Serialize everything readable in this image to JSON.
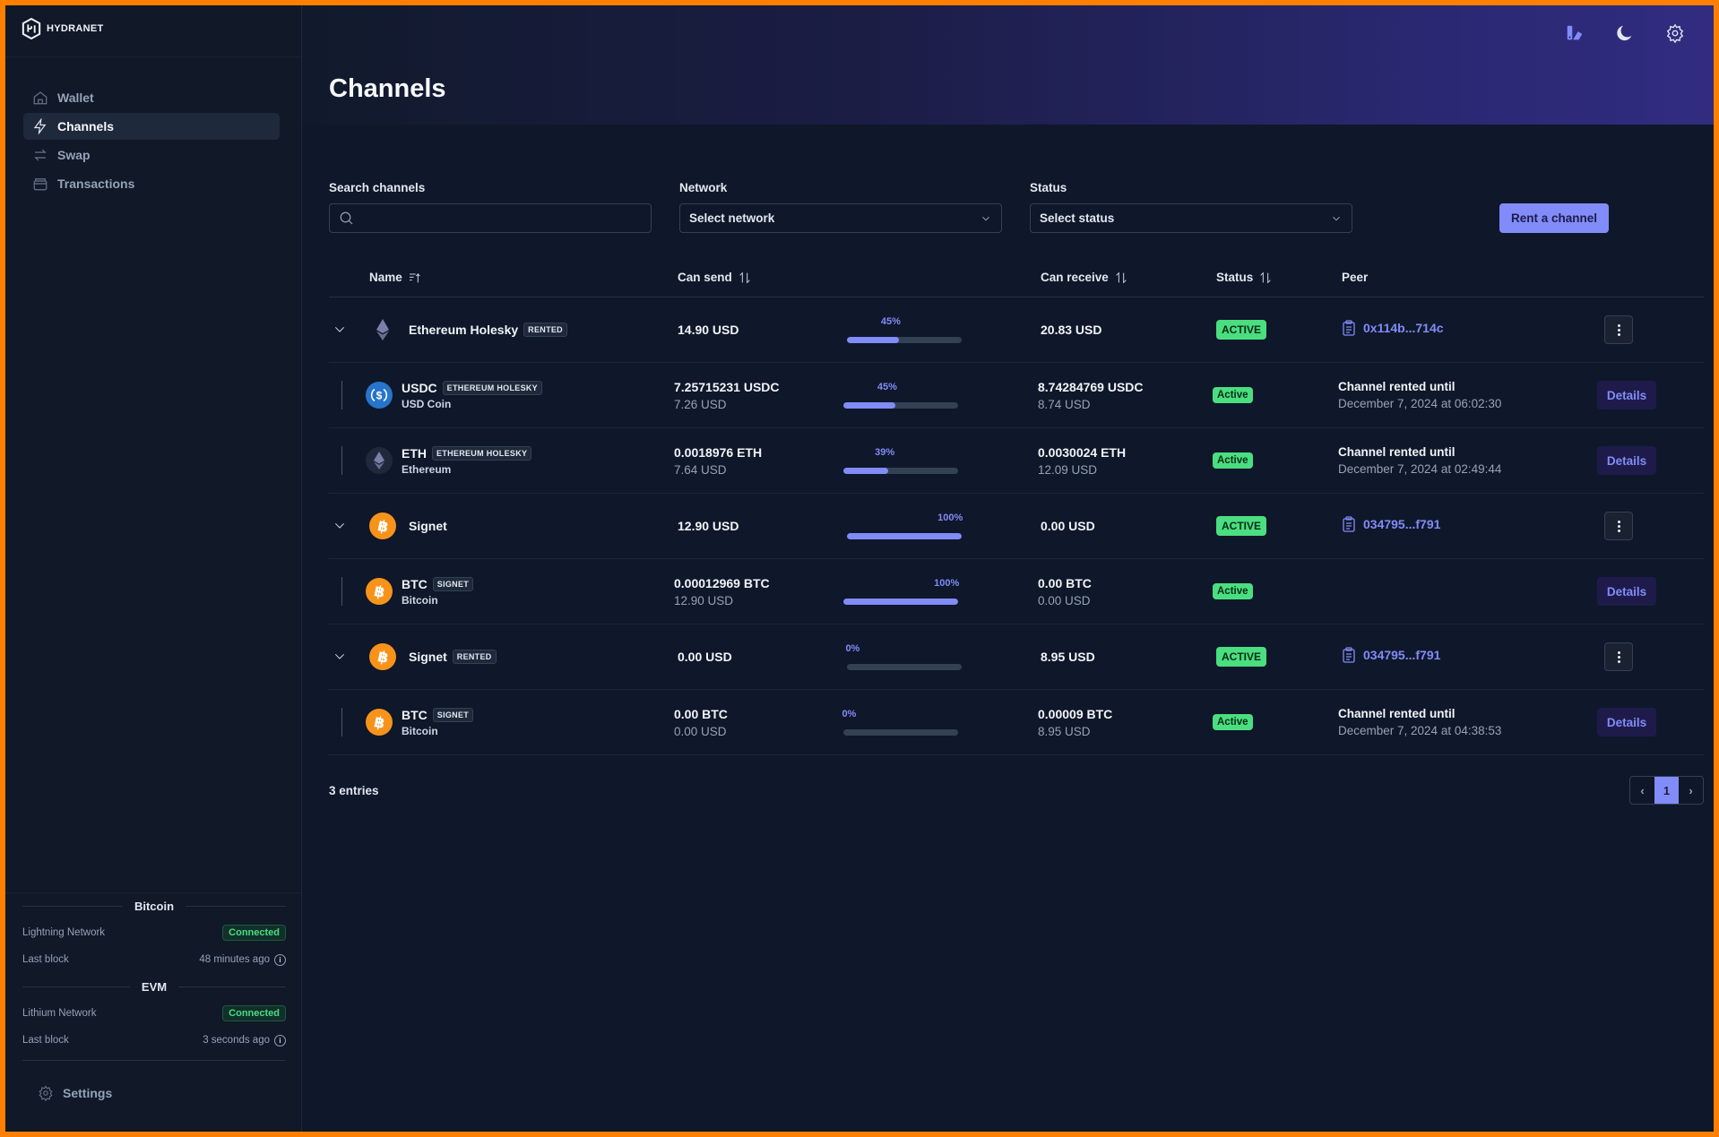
{
  "app": {
    "brand": "HYDRANET"
  },
  "sidebar": {
    "items": [
      {
        "label": "Wallet",
        "icon": "home-icon",
        "active": false
      },
      {
        "label": "Channels",
        "icon": "lightning-icon",
        "active": true
      },
      {
        "label": "Swap",
        "icon": "swap-arrows-icon",
        "active": false
      },
      {
        "label": "Transactions",
        "icon": "archive-icon",
        "active": false
      }
    ],
    "status": {
      "bitcoin": {
        "title": "Bitcoin",
        "network_label": "Lightning Network",
        "network_status": "Connected",
        "last_block_label": "Last block",
        "last_block_value": "48 minutes ago"
      },
      "evm": {
        "title": "EVM",
        "network_label": "Lithium Network",
        "network_status": "Connected",
        "last_block_label": "Last block",
        "last_block_value": "3 seconds ago"
      }
    },
    "settings_label": "Settings"
  },
  "header": {
    "title": "Channels",
    "icons": [
      "swatch-icon",
      "moon-icon",
      "gear-icon"
    ]
  },
  "filters": {
    "search": {
      "label": "Search channels",
      "value": "",
      "placeholder": ""
    },
    "network": {
      "label": "Network",
      "value": "Select network"
    },
    "status": {
      "label": "Status",
      "value": "Select status"
    },
    "rent_button": "Rent a channel"
  },
  "table": {
    "columns": {
      "name": "Name",
      "can_send": "Can send",
      "can_receive": "Can receive",
      "status": "Status",
      "peer": "Peer"
    },
    "rows": [
      {
        "type": "group",
        "coin": "eth",
        "name": "Ethereum Holesky",
        "tag": "RENTED",
        "can_send": "14.90 USD",
        "send_pct": 45,
        "send_pct_label": "45%",
        "can_receive": "20.83 USD",
        "status": "ACTIVE",
        "peer": "0x114b...714c"
      },
      {
        "type": "child",
        "coin": "usdc",
        "name": "USDC",
        "tag": "ETHEREUM HOLESKY",
        "sub": "USD Coin",
        "can_send": "7.25715231 USDC",
        "can_send_usd": "7.26 USD",
        "send_pct": 45,
        "send_pct_label": "45%",
        "can_receive": "8.74284769 USDC",
        "can_receive_usd": "8.74 USD",
        "status": "Active",
        "rent_title": "Channel rented until",
        "rent_until": "December 7, 2024 at 06:02:30",
        "action": "Details"
      },
      {
        "type": "child",
        "coin": "eth",
        "name": "ETH",
        "tag": "ETHEREUM HOLESKY",
        "sub": "Ethereum",
        "can_send": "0.0018976 ETH",
        "can_send_usd": "7.64 USD",
        "send_pct": 39,
        "send_pct_label": "39%",
        "can_receive": "0.0030024 ETH",
        "can_receive_usd": "12.09 USD",
        "status": "Active",
        "rent_title": "Channel rented until",
        "rent_until": "December 7, 2024 at 02:49:44",
        "action": "Details"
      },
      {
        "type": "group",
        "coin": "btc",
        "name": "Signet",
        "tag": "",
        "can_send": "12.90 USD",
        "send_pct": 100,
        "send_pct_label": "100%",
        "can_receive": "0.00 USD",
        "status": "ACTIVE",
        "peer": "034795...f791"
      },
      {
        "type": "child",
        "coin": "btc",
        "name": "BTC",
        "tag": "SIGNET",
        "sub": "Bitcoin",
        "can_send": "0.00012969 BTC",
        "can_send_usd": "12.90 USD",
        "send_pct": 100,
        "send_pct_label": "100%",
        "can_receive": "0.00 BTC",
        "can_receive_usd": "0.00 USD",
        "status": "Active",
        "rent_title": "",
        "rent_until": "",
        "action": "Details"
      },
      {
        "type": "group",
        "coin": "btc",
        "name": "Signet",
        "tag": "RENTED",
        "can_send": "0.00 USD",
        "send_pct": 0,
        "send_pct_label": "0%",
        "can_receive": "8.95 USD",
        "status": "ACTIVE",
        "peer": "034795...f791"
      },
      {
        "type": "child",
        "coin": "btc",
        "name": "BTC",
        "tag": "SIGNET",
        "sub": "Bitcoin",
        "can_send": "0.00 BTC",
        "can_send_usd": "0.00 USD",
        "send_pct": 0,
        "send_pct_label": "0%",
        "can_receive": "0.00009 BTC",
        "can_receive_usd": "8.95 USD",
        "status": "Active",
        "rent_title": "Channel rented until",
        "rent_until": "December 7, 2024 at 04:38:53",
        "action": "Details"
      }
    ]
  },
  "footer": {
    "entries": "3 entries",
    "current_page": "1"
  },
  "colors": {
    "accent": "#818cf8",
    "active": "#4ade80",
    "btc": "#f7931a",
    "usdc": "#2775ca",
    "frame": "#ff7f00"
  }
}
